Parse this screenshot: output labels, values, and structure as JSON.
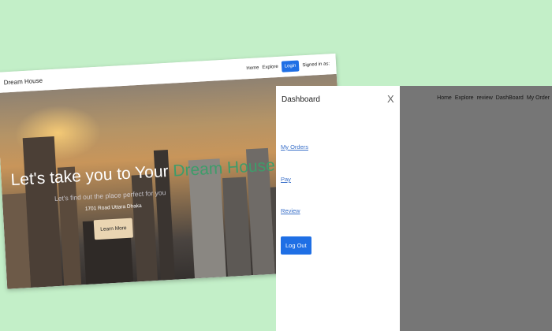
{
  "landing": {
    "brand": "Dream House",
    "nav": {
      "home": "Home",
      "explore": "Explore",
      "login": "Login",
      "status": "Signed in as:"
    },
    "hero": {
      "title_main": "Let's take you to Your",
      "title_accent": "Dream House",
      "subtitle": "Let's find out the place perfect for you",
      "address": "1701 Road Uttara Dhaka",
      "button": "Learn More"
    }
  },
  "dashboard": {
    "drawer": {
      "title": "Dashboard",
      "close": "X",
      "links": [
        "My Orders",
        "Pay",
        "Review"
      ],
      "logout": "Log Out"
    },
    "topnav": [
      "Home",
      "Explore",
      "review",
      "DashBoard",
      "My Order"
    ]
  },
  "colors": {
    "background": "#c3efc8",
    "primary": "#1f6fe5",
    "accent": "#3e9c6a"
  }
}
